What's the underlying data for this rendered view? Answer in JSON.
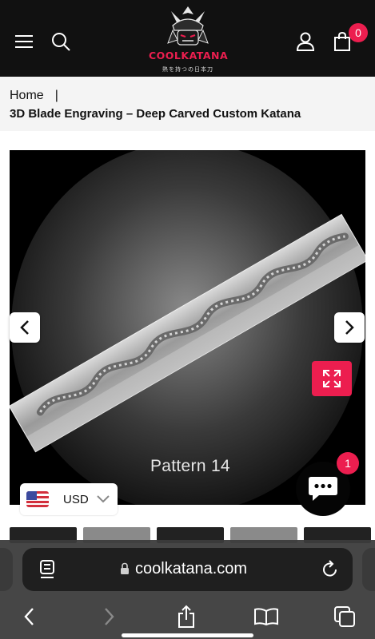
{
  "header": {
    "logo_text": "COOLKATANA",
    "logo_subtitle": "熱を持つの日本刀",
    "cart_count": "0"
  },
  "breadcrumb": {
    "home": "Home",
    "separator": "|",
    "title": "3D Blade Engraving – Deep Carved Custom Katana"
  },
  "product": {
    "caption": "Pattern 14"
  },
  "currency": {
    "code": "USD"
  },
  "chat": {
    "badge": "1"
  },
  "browser": {
    "url": "coolkatana.com"
  },
  "colors": {
    "accent": "#ec1e4f",
    "header_bg": "#111111",
    "breadcrumb_bg": "#f4f4f4"
  }
}
